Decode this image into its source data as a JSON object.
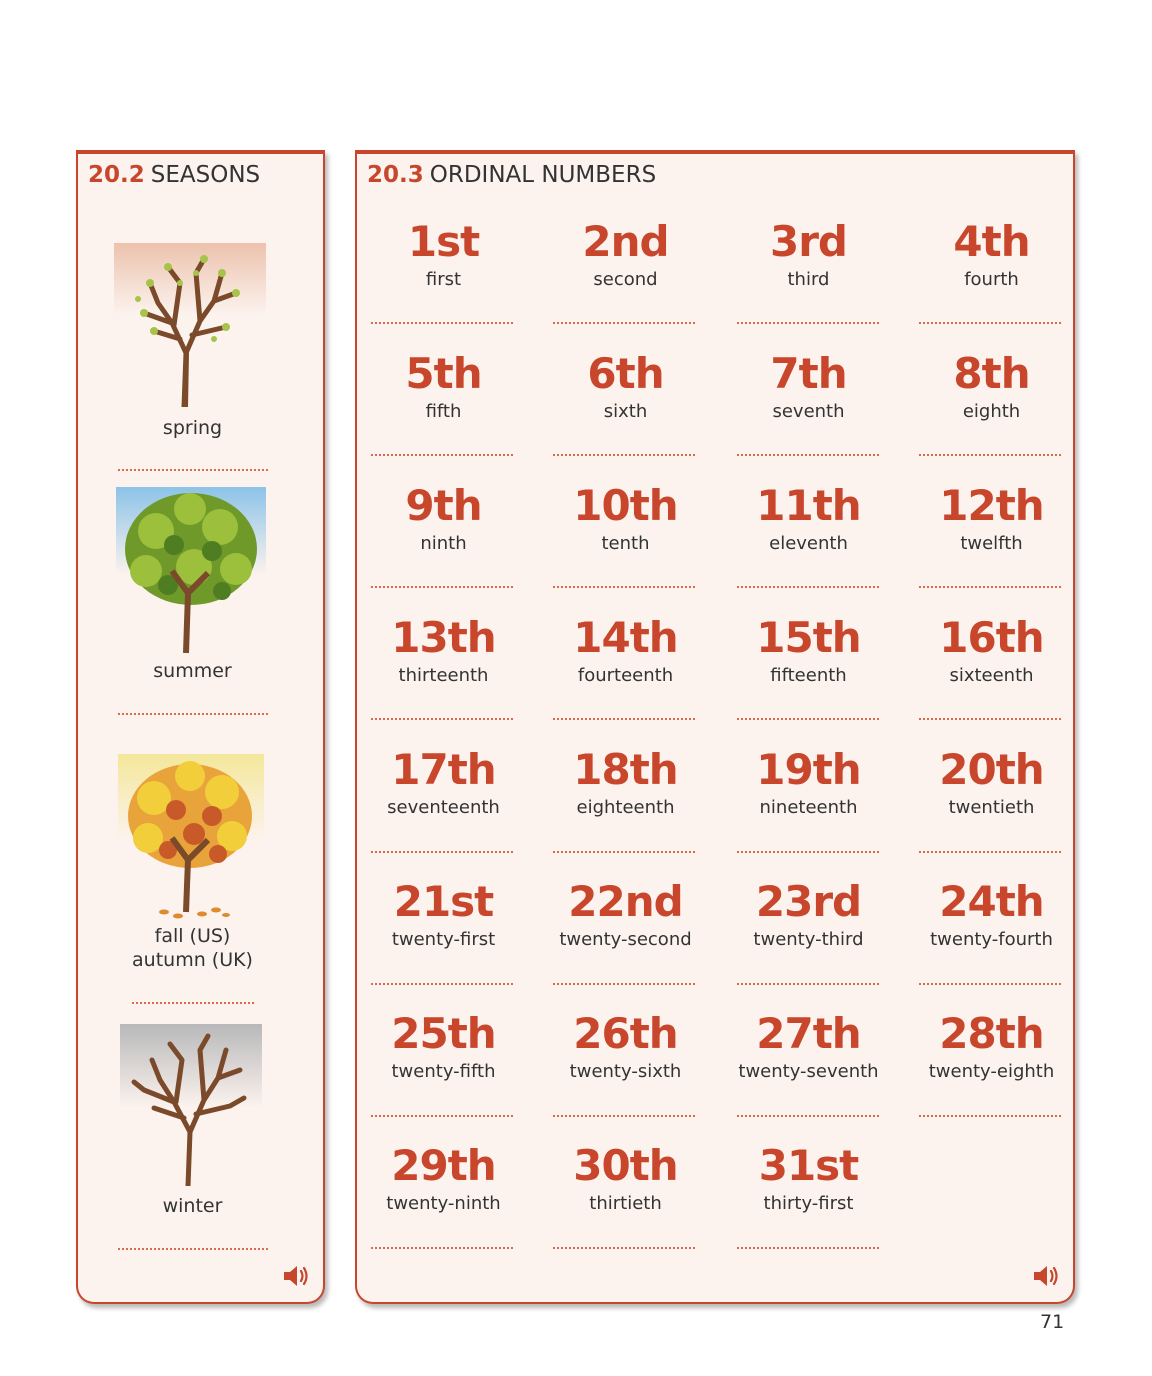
{
  "seasons": {
    "section_number": "20.2",
    "title": "SEASONS",
    "items": [
      {
        "label": "spring"
      },
      {
        "label": "summer"
      },
      {
        "label": "fall (US)",
        "label2": "autumn (UK)"
      },
      {
        "label": "winter"
      }
    ],
    "audio_icon": "speaker-icon"
  },
  "ordinals": {
    "section_number": "20.3",
    "title": "ORDINAL NUMBERS",
    "items": [
      {
        "numeral": "1st",
        "word": "first"
      },
      {
        "numeral": "2nd",
        "word": "second"
      },
      {
        "numeral": "3rd",
        "word": "third"
      },
      {
        "numeral": "4th",
        "word": "fourth"
      },
      {
        "numeral": "5th",
        "word": "fifth"
      },
      {
        "numeral": "6th",
        "word": "sixth"
      },
      {
        "numeral": "7th",
        "word": "seventh"
      },
      {
        "numeral": "8th",
        "word": "eighth"
      },
      {
        "numeral": "9th",
        "word": "ninth"
      },
      {
        "numeral": "10th",
        "word": "tenth"
      },
      {
        "numeral": "11th",
        "word": "eleventh"
      },
      {
        "numeral": "12th",
        "word": "twelfth"
      },
      {
        "numeral": "13th",
        "word": "thirteenth"
      },
      {
        "numeral": "14th",
        "word": "fourteenth"
      },
      {
        "numeral": "15th",
        "word": "fifteenth"
      },
      {
        "numeral": "16th",
        "word": "sixteenth"
      },
      {
        "numeral": "17th",
        "word": "seventeenth"
      },
      {
        "numeral": "18th",
        "word": "eighteenth"
      },
      {
        "numeral": "19th",
        "word": "nineteenth"
      },
      {
        "numeral": "20th",
        "word": "twentieth"
      },
      {
        "numeral": "21st",
        "word": "twenty-first"
      },
      {
        "numeral": "22nd",
        "word": "twenty-second"
      },
      {
        "numeral": "23rd",
        "word": "twenty-third"
      },
      {
        "numeral": "24th",
        "word": "twenty-fourth"
      },
      {
        "numeral": "25th",
        "word": "twenty-fifth"
      },
      {
        "numeral": "26th",
        "word": "twenty-sixth"
      },
      {
        "numeral": "27th",
        "word": "twenty-seventh"
      },
      {
        "numeral": "28th",
        "word": "twenty-eighth"
      },
      {
        "numeral": "29th",
        "word": "twenty-ninth"
      },
      {
        "numeral": "30th",
        "word": "thirtieth"
      },
      {
        "numeral": "31st",
        "word": "thirty-first"
      }
    ],
    "audio_icon": "speaker-icon"
  },
  "page_number": "71",
  "colors": {
    "accent": "#c8462c",
    "panel_bg": "#fcf3ee",
    "text": "#333333"
  }
}
